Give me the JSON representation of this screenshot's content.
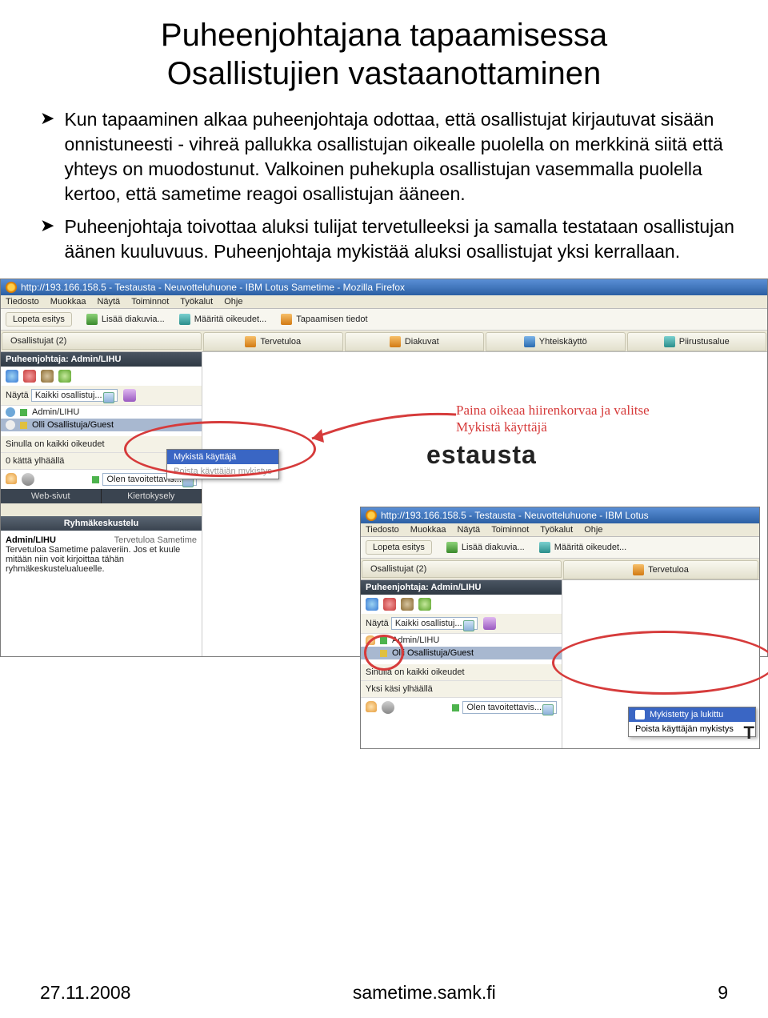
{
  "slide": {
    "title_line1": "Puheenjohtajana tapaamisessa",
    "title_line2": "Osallistujien vastaanottaminen"
  },
  "bullets": [
    "Kun tapaaminen alkaa puheenjohtaja odottaa, että osallistujat kirjautuvat sisään onnistuneesti - vihreä pallukka osallistujan oikealle puolella on merkkinä siitä että yhteys on muodostunut. Valkoinen puhekupla osallistujan vasemmalla puolella kertoo, että sametime reagoi osallistujan ääneen.",
    "Puheenjohtaja toivottaa aluksi tulijat tervetulleeksi ja samalla testataan osallistujan äänen kuuluvuus. Puheenjohtaja mykistää aluksi osallistujat yksi kerrallaan."
  ],
  "annotations": {
    "mute_hint": "Paina oikeaa hiirenkorvaa ja valitse Mykistä käyttäjä"
  },
  "main_window": {
    "title": "http://193.166.158.5 - Testausta - Neuvotteluhuone - IBM Lotus Sametime - Mozilla Firefox",
    "menus": [
      "Tiedosto",
      "Muokkaa",
      "Näytä",
      "Toiminnot",
      "Työkalut",
      "Ohje"
    ],
    "toolbar": {
      "stop": "Lopeta esitys",
      "add_slide": "Lisää diakuvia...",
      "permissions": "Määritä oikeudet...",
      "info": "Tapaamisen tiedot"
    },
    "tabs": {
      "participants": "Osallistujat (2)",
      "welcome": "Tervetuloa",
      "slides": "Diakuvat",
      "sharing": "Yhteiskäyttö",
      "whiteboard": "Piirustusalue"
    },
    "moderator_label": "Puheenjohtaja: Admin/LIHU",
    "show_label": "Näytä",
    "show_value": "Kaikki osallistuj...",
    "participants": [
      {
        "name": "Admin/LIHU",
        "status": "green"
      },
      {
        "name": "Olli Osallistuja/Guest",
        "status": "yellow"
      }
    ],
    "rights_text": "Sinulla on kaikki oikeudet",
    "hands_text": "0 kättä ylhäällä",
    "presence": "Olen tavoitettavis...",
    "web_tab": "Web-sivut",
    "poll_tab": "Kiertokysely",
    "chat_header": "Ryhmäkeskustelu",
    "chat_user": "Admin/LIHU",
    "chat_msg_intro": "Tervetuloa Sametime palaveriin. Jos et kuule mitään niin voit kirjoittaa tähän ryhmäkeskustelualueelle.",
    "context_menu": {
      "mute": "Mykistä käyttäjä"
    },
    "bg_title": "estausta"
  },
  "sub_window": {
    "title": "http://193.166.158.5 - Testausta - Neuvotteluhuone - IBM Lotus",
    "menus": [
      "Tiedosto",
      "Muokkaa",
      "Näytä",
      "Toiminnot",
      "Työkalut",
      "Ohje"
    ],
    "toolbar": {
      "stop": "Lopeta esitys",
      "add_slide": "Lisää diakuvia...",
      "permissions": "Määritä oikeudet..."
    },
    "participants_tab": "Osallistujat (2)",
    "welcome_tab": "Tervetuloa",
    "moderator_label": "Puheenjohtaja: Admin/LIHU",
    "show_label": "Näytä",
    "show_value": "Kaikki osallistuj...",
    "participants": [
      {
        "name": "Admin/LIHU",
        "status": "green"
      },
      {
        "name": "Olli Osallistuja/Guest",
        "status": "yellow"
      }
    ],
    "rights_text": "Sinulla on kaikki oikeudet",
    "hands_text": "Yksi käsi ylhäällä",
    "presence": "Olen tavoitettavis...",
    "context_menu": {
      "muted": "Mykistetty ja lukittu",
      "unmute": "Poista käyttäjän mykistys"
    }
  },
  "footer": {
    "date": "27.11.2008",
    "center": "sametime.samk.fi",
    "page": "9"
  }
}
